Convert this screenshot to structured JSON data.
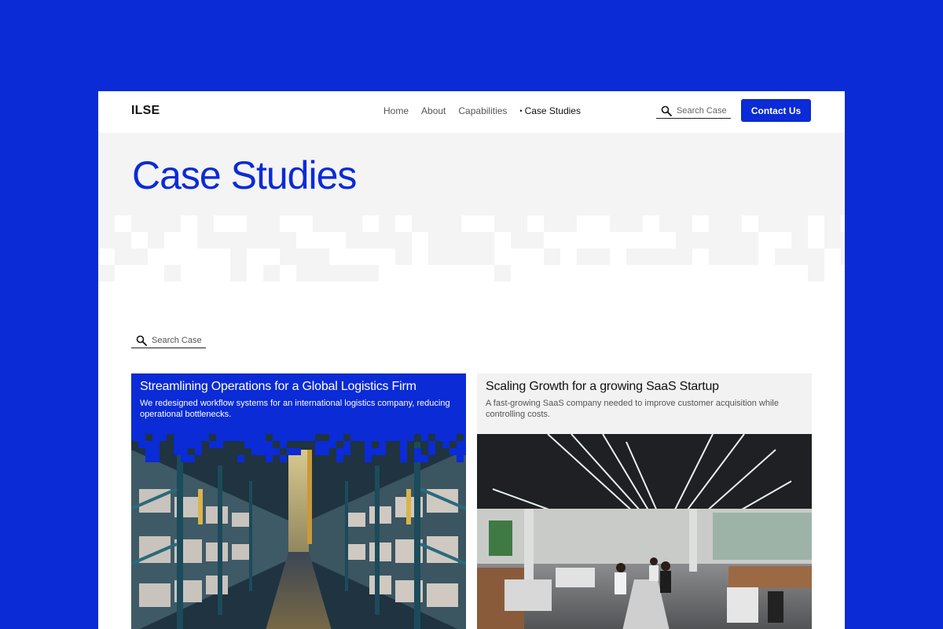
{
  "header": {
    "logo": "ILSE",
    "nav": [
      "Home",
      "About",
      "Capabilities",
      "Case Studies"
    ],
    "active_nav": "Case Studies",
    "search_placeholder": "Search Case",
    "contact_label": "Contact Us"
  },
  "hero": {
    "title": "Case Studies"
  },
  "search": {
    "placeholder": "Search Case"
  },
  "cards": [
    {
      "title": "Streamlining Operations for a Global Logistics Firm",
      "description": "We redesigned workflow systems for an international logistics company, reducing operational bottlenecks.",
      "image": "warehouse-aisle-photo"
    },
    {
      "title": "Scaling Growth for a growing SaaS Startup",
      "description": "A fast-growing SaaS company needed to improve customer acquisition while controlling costs.",
      "image": "open-office-photo"
    }
  ],
  "colors": {
    "brand": "#0A2BD6",
    "hero_bg": "#F4F4F4",
    "card_light_bg": "#F2F2F2",
    "text_dark": "#111111"
  }
}
